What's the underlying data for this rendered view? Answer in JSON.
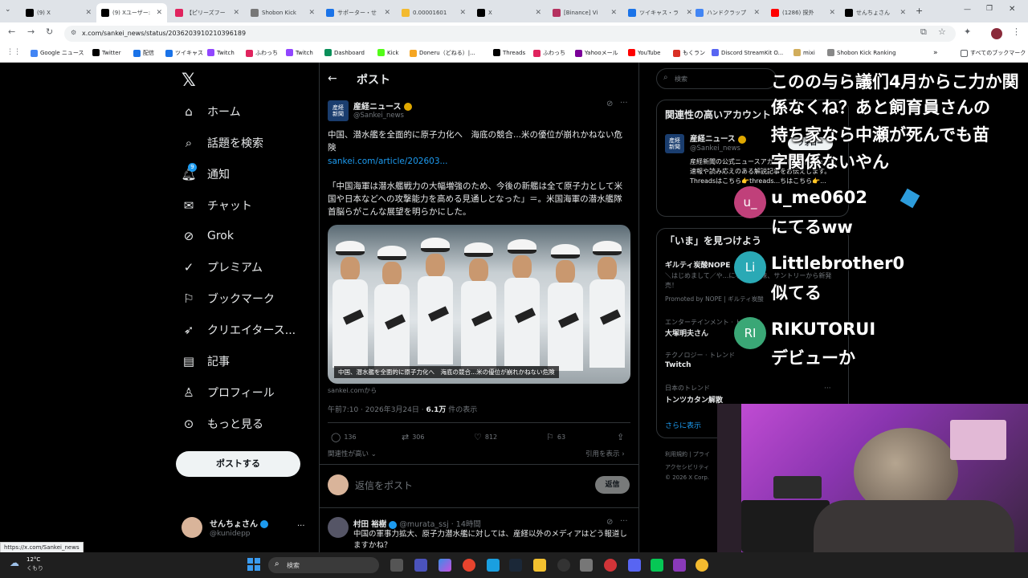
{
  "browser": {
    "tabs": [
      {
        "label": "(9) X",
        "color": "#000000"
      },
      {
        "label": "(9) Xユーザー: ",
        "color": "#000000"
      },
      {
        "label": "【ピリーズフー",
        "color": "#e0245e"
      },
      {
        "label": "Shobon Kick",
        "color": "#777777"
      },
      {
        "label": "サポーター・せ",
        "color": "#1a73e8"
      },
      {
        "label": "0.00001601",
        "color": "#f3ba2f"
      },
      {
        "label": "X",
        "color": "#000000"
      },
      {
        "label": "[Binance] Vi",
        "color": "#b5315f"
      },
      {
        "label": "ツイキャス・ラ",
        "color": "#1a73e8"
      },
      {
        "label": "ハンドクラップ",
        "color": "#4285f4"
      },
      {
        "label": "(1286) 探外",
        "color": "#ff0000"
      },
      {
        "label": "せんちょさん",
        "color": "#000000"
      }
    ],
    "url": "x.com/sankei_news/status/2036203910210396189",
    "bookmarks": [
      {
        "label": "Google ニュース",
        "color": "#4285f4"
      },
      {
        "label": "Twitter",
        "color": "#000000"
      },
      {
        "label": "配信",
        "color": "#1a73e8"
      },
      {
        "label": "ツイキャス",
        "color": "#1a73e8"
      },
      {
        "label": "Twitch",
        "color": "#9146ff"
      },
      {
        "label": "ふわっち",
        "color": "#e0245e"
      },
      {
        "label": "Twitch",
        "color": "#9146ff"
      },
      {
        "label": "Dashboard",
        "color": "#0a8f5a"
      },
      {
        "label": "Kick",
        "color": "#53fc18"
      },
      {
        "label": "Doneru（どねる）|...",
        "color": "#f5a623"
      },
      {
        "label": "Threads",
        "color": "#000000"
      },
      {
        "label": "ふわっち",
        "color": "#e0245e"
      },
      {
        "label": "Yahooメール",
        "color": "#7b0099"
      },
      {
        "label": "YouTube",
        "color": "#ff0000"
      },
      {
        "label": "もくラン",
        "color": "#d93025"
      },
      {
        "label": "Discord StreamKit O...",
        "color": "#5865f2"
      },
      {
        "label": "mixi",
        "color": "#d1ad5b"
      },
      {
        "label": "Shobon Kick Ranking",
        "color": "#888888"
      }
    ],
    "all_bookmarks": "すべてのブックマーク",
    "status_url": "https://x.com/Sankei_news"
  },
  "nav": {
    "items": [
      "ホーム",
      "話題を検索",
      "通知",
      "チャット",
      "Grok",
      "プレミアム",
      "ブックマーク",
      "クリエイタース...",
      "記事",
      "プロフィール",
      "もっと見る"
    ],
    "notif_count": "9",
    "post_button": "ポストする",
    "user_name": "せんちょさん",
    "user_handle": "@kunidepp"
  },
  "post": {
    "header": "ポスト",
    "author": "産経ニュース",
    "handle": "@Sankei_news",
    "headline": "中国、潜水艦を全面的に原子力化へ　海底の競合...米の優位が崩れかねない危険",
    "link": "sankei.com/article/202603...",
    "body": "「中国海軍は潜水艦戦力の大幅増強のため、今後の新艦は全て原子力として米国や日本などへの攻撃能力を高める見通しとなった」＝。米国海軍の潜水艦隊首脳らがこんな展望を明らかにした。",
    "image_caption": "中国、潜水艦を全面的に原子力化へ　海底の競合...米の優位が崩れかねない危険",
    "source": "sankei.comから",
    "timestamp": "午前7:10 · 2026年3月24日 · ",
    "views": "6.1万",
    "views_suffix": " 件の表示",
    "replies": "136",
    "reposts": "306",
    "likes": "812",
    "bookmarks": "63",
    "sort_label": "関連性が高い",
    "quotes_label": "引用を表示",
    "reply_placeholder": "返信をポスト",
    "reply_button": "返信"
  },
  "reply": {
    "author": "村田 裕樹",
    "handle": "@murata_ssj · 14時間",
    "text": "中国の軍事力拡大、原子力潜水艦に対しては、産経以外のメディアはどう報道しますかね？"
  },
  "sidebar": {
    "search_placeholder": "検索",
    "related_title": "関連性の高いアカウント",
    "related_name": "産経ニュース",
    "related_handle": "@Sankei_news",
    "follow": "フォロー",
    "related_bio": "産経新聞の公式ニュースアカウントです。ニュース速報や読み応えのある解説記事をお伝えします。Threadsはこちら👉threads...ちはこちら👉...",
    "now_title": "「いま」を見つけよう",
    "trend1_title": "ギルティ炭酸NOPE",
    "trend1_desc": "＼はじめまして／や...になる罪な味、サントリーから新発売！",
    "trend1_promo": "Promoted by NOPE | ギルティ炭酸",
    "trend2_cat": "エンターテインメント · トレンド",
    "trend2_title": "大塚明夫さん",
    "trend3_cat": "テクノロジー · トレンド",
    "trend3_title": "Twitch",
    "trend4_cat": "日本のトレンド",
    "trend4_title": "トンツカタン解散",
    "more": "さらに表示",
    "footer1": "利用規約 | プライ",
    "footer2": "アクセシビリティ",
    "footer3": "© 2026 X Corp."
  },
  "chat": {
    "line1": "このの与ら議们4月からこ力か関",
    "line2": "係なくね？あと飼育員さんの",
    "line3": "持ち家なら中瀬が死んでも苗",
    "line4": "字関係ないやん",
    "user1": "u_me0602",
    "user1_initial": "u_",
    "msg1": "にてるww",
    "user2": "Littlebrother0",
    "user2_initial": "Li",
    "msg2": "似てる",
    "user3": "RIKUTORUI",
    "user3_initial": "RI",
    "msg3": "デビューか"
  },
  "taskbar": {
    "weather_temp": "12°C",
    "weather_desc": "くもり",
    "search": "検索"
  }
}
